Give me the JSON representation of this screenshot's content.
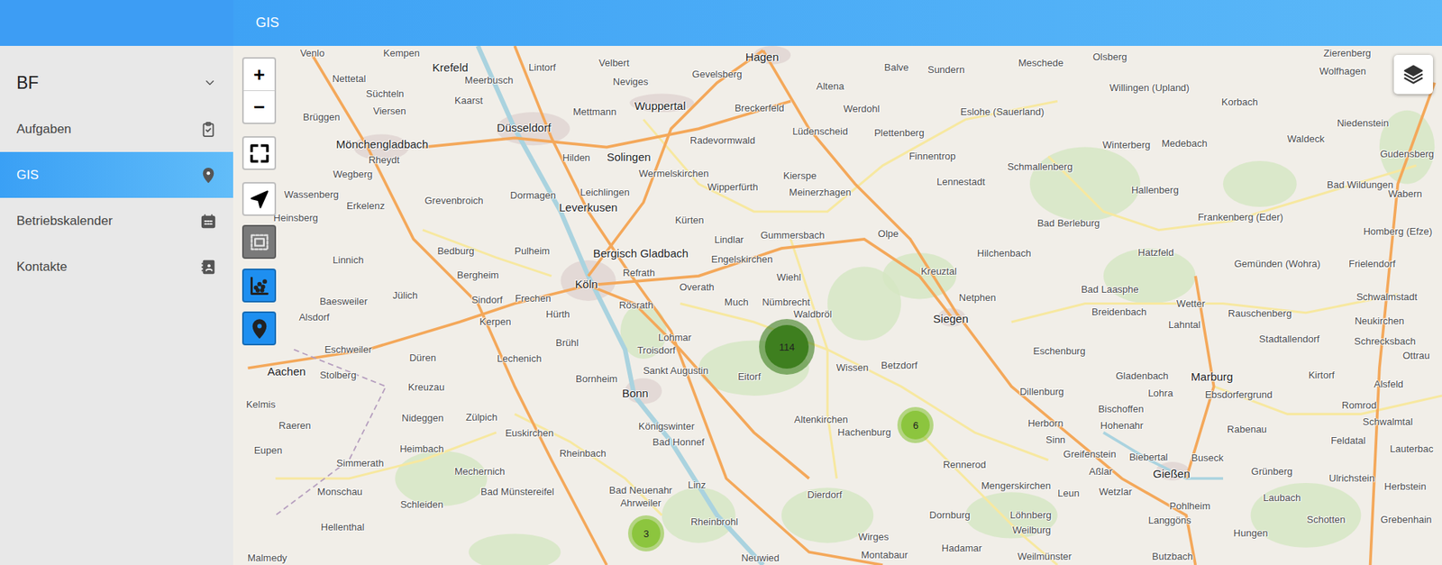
{
  "header": {
    "title": "GIS"
  },
  "sidebar": {
    "group": {
      "label": "BF",
      "expanded": true
    },
    "items": [
      {
        "label": "Aufgaben",
        "selected": false
      },
      {
        "label": "GIS",
        "selected": true
      },
      {
        "label": "Betriebskalender",
        "selected": false
      },
      {
        "label": "Kontakte",
        "selected": false
      }
    ]
  },
  "map": {
    "zoom": {
      "in": "+",
      "out": "−"
    },
    "tools": [
      {
        "active": false
      },
      {
        "active": true
      },
      {
        "active": true
      }
    ],
    "clusters": [
      {
        "count": "114",
        "color": "#3e7f1f"
      },
      {
        "count": "6",
        "color": "#8cc53e"
      },
      {
        "count": "3",
        "color": "#8cc53e"
      }
    ],
    "labels": [
      {
        "text": "Venlo",
        "kind": "town"
      },
      {
        "text": "Kempen",
        "kind": "town"
      },
      {
        "text": "Krefeld",
        "kind": "city"
      },
      {
        "text": "Lintorf",
        "kind": "town"
      },
      {
        "text": "Velbert",
        "kind": "town"
      },
      {
        "text": "Hagen",
        "kind": "city"
      },
      {
        "text": "Gevelsberg",
        "kind": "town"
      },
      {
        "text": "Balve",
        "kind": "town"
      },
      {
        "text": "Sundern",
        "kind": "town"
      },
      {
        "text": "Meschede",
        "kind": "town"
      },
      {
        "text": "Olsberg",
        "kind": "town"
      },
      {
        "text": "Zierenberg",
        "kind": "town"
      },
      {
        "text": "Nettetal",
        "kind": "town"
      },
      {
        "text": "Meerbusch",
        "kind": "town"
      },
      {
        "text": "Neviges",
        "kind": "town"
      },
      {
        "text": "Altena",
        "kind": "town"
      },
      {
        "text": "Willingen (Upland)",
        "kind": "town"
      },
      {
        "text": "Wolfhagen",
        "kind": "town"
      },
      {
        "text": "Süchteln",
        "kind": "town"
      },
      {
        "text": "Kaarst",
        "kind": "town"
      },
      {
        "text": "Wuppertal",
        "kind": "city"
      },
      {
        "text": "Mettmann",
        "kind": "town"
      },
      {
        "text": "Breckerfeld",
        "kind": "town"
      },
      {
        "text": "Werdohl",
        "kind": "town"
      },
      {
        "text": "Eslohe (Sauerland)",
        "kind": "town"
      },
      {
        "text": "Korbach",
        "kind": "town"
      },
      {
        "text": "Viersen",
        "kind": "town"
      },
      {
        "text": "Brüggen",
        "kind": "town"
      },
      {
        "text": "Düsseldorf",
        "kind": "city"
      },
      {
        "text": "Niedenstein",
        "kind": "town"
      },
      {
        "text": "Mönchengladbach",
        "kind": "city"
      },
      {
        "text": "Lüdenscheid",
        "kind": "town"
      },
      {
        "text": "Plettenberg",
        "kind": "town"
      },
      {
        "text": "Radevormwald",
        "kind": "town"
      },
      {
        "text": "Waldeck",
        "kind": "town"
      },
      {
        "text": "Winterberg",
        "kind": "town"
      },
      {
        "text": "Medebach",
        "kind": "town"
      },
      {
        "text": "Hilden",
        "kind": "town"
      },
      {
        "text": "Solingen",
        "kind": "city"
      },
      {
        "text": "Finnentrop",
        "kind": "town"
      },
      {
        "text": "Rheydt",
        "kind": "town"
      },
      {
        "text": "Gudensberg",
        "kind": "town"
      },
      {
        "text": "Schmallenberg",
        "kind": "town"
      },
      {
        "text": "Wegberg",
        "kind": "town"
      },
      {
        "text": "Wermelskirchen",
        "kind": "town"
      },
      {
        "text": "Kierspe",
        "kind": "town"
      },
      {
        "text": "Lennestadt",
        "kind": "town"
      },
      {
        "text": "Bad Wildungen",
        "kind": "town"
      },
      {
        "text": "Wipperfürth",
        "kind": "town"
      },
      {
        "text": "Leichlingen",
        "kind": "town"
      },
      {
        "text": "Meinerzhagen",
        "kind": "town"
      },
      {
        "text": "Hallenberg",
        "kind": "town"
      },
      {
        "text": "Wassenberg",
        "kind": "town"
      },
      {
        "text": "Wabern",
        "kind": "town"
      },
      {
        "text": "Dormagen",
        "kind": "town"
      },
      {
        "text": "Grevenbroich",
        "kind": "town"
      },
      {
        "text": "Erkelenz",
        "kind": "town"
      },
      {
        "text": "Leverkusen",
        "kind": "city"
      },
      {
        "text": "Heinsberg",
        "kind": "town"
      },
      {
        "text": "Frankenberg (Eder)",
        "kind": "town"
      },
      {
        "text": "Kürten",
        "kind": "town"
      },
      {
        "text": "Bad Berleburg",
        "kind": "town"
      },
      {
        "text": "Homberg (Efze)",
        "kind": "town"
      },
      {
        "text": "Gummersbach",
        "kind": "town"
      },
      {
        "text": "Olpe",
        "kind": "town"
      },
      {
        "text": "Lindlar",
        "kind": "town"
      },
      {
        "text": "Bedburg",
        "kind": "town"
      },
      {
        "text": "Pulheim",
        "kind": "town"
      },
      {
        "text": "Bergisch Gladbach",
        "kind": "city"
      },
      {
        "text": "Hilchenbach",
        "kind": "town"
      },
      {
        "text": "Hatzfeld",
        "kind": "town"
      },
      {
        "text": "Engelskirchen",
        "kind": "town"
      },
      {
        "text": "Linnich",
        "kind": "town"
      },
      {
        "text": "Gemünden (Wohra)",
        "kind": "town"
      },
      {
        "text": "Frielendorf",
        "kind": "town"
      },
      {
        "text": "Kreuztal",
        "kind": "town"
      },
      {
        "text": "Refrath",
        "kind": "town"
      },
      {
        "text": "Bergheim",
        "kind": "town"
      },
      {
        "text": "Wiehl",
        "kind": "town"
      },
      {
        "text": "Köln",
        "kind": "city"
      },
      {
        "text": "Overath",
        "kind": "town"
      },
      {
        "text": "Bad Laasphe",
        "kind": "town"
      },
      {
        "text": "Jülich",
        "kind": "town"
      },
      {
        "text": "Schwalmstadt",
        "kind": "town"
      },
      {
        "text": "Netphen",
        "kind": "town"
      },
      {
        "text": "Frechen",
        "kind": "town"
      },
      {
        "text": "Sindorf",
        "kind": "town"
      },
      {
        "text": "Baesweiler",
        "kind": "town"
      },
      {
        "text": "Much",
        "kind": "town"
      },
      {
        "text": "Nümbrecht",
        "kind": "town"
      },
      {
        "text": "Wetter",
        "kind": "town"
      },
      {
        "text": "Rösrath",
        "kind": "town"
      },
      {
        "text": "Breidenbach",
        "kind": "town"
      },
      {
        "text": "Rauschenberg",
        "kind": "town"
      },
      {
        "text": "Hürth",
        "kind": "town"
      },
      {
        "text": "Alsdorf",
        "kind": "town"
      },
      {
        "text": "Waldbröl",
        "kind": "town"
      },
      {
        "text": "Siegen",
        "kind": "city"
      },
      {
        "text": "Kerpen",
        "kind": "town"
      },
      {
        "text": "Neukirchen",
        "kind": "town"
      },
      {
        "text": "Lahntal",
        "kind": "town"
      },
      {
        "text": "Lohmar",
        "kind": "town"
      },
      {
        "text": "Stadtallendorf",
        "kind": "town"
      },
      {
        "text": "Schrecksbach",
        "kind": "town"
      },
      {
        "text": "Brühl",
        "kind": "town"
      },
      {
        "text": "Eschweiler",
        "kind": "town"
      },
      {
        "text": "Troisdorf",
        "kind": "town"
      },
      {
        "text": "Eschenburg",
        "kind": "town"
      },
      {
        "text": "Ottrau",
        "kind": "town"
      },
      {
        "text": "Düren",
        "kind": "town"
      },
      {
        "text": "Lechenich",
        "kind": "town"
      },
      {
        "text": "Betzdorf",
        "kind": "town"
      },
      {
        "text": "Wissen",
        "kind": "town"
      },
      {
        "text": "Sankt Augustin",
        "kind": "town"
      },
      {
        "text": "Aachen",
        "kind": "city"
      },
      {
        "text": "Stolberg",
        "kind": "town"
      },
      {
        "text": "Eitorf",
        "kind": "town"
      },
      {
        "text": "Marburg",
        "kind": "city"
      },
      {
        "text": "Gladenbach",
        "kind": "town"
      },
      {
        "text": "Kirtorf",
        "kind": "town"
      },
      {
        "text": "Bornheim",
        "kind": "town"
      },
      {
        "text": "Alsfeld",
        "kind": "town"
      },
      {
        "text": "Kreuzau",
        "kind": "town"
      },
      {
        "text": "Dillenburg",
        "kind": "town"
      },
      {
        "text": "Lohra",
        "kind": "town"
      },
      {
        "text": "Bonn",
        "kind": "city"
      },
      {
        "text": "Ebsdorfergrund",
        "kind": "town"
      },
      {
        "text": "Kelmis",
        "kind": "town"
      },
      {
        "text": "Romrod",
        "kind": "town"
      },
      {
        "text": "Bischoffen",
        "kind": "town"
      },
      {
        "text": "Zülpich",
        "kind": "town"
      },
      {
        "text": "Nideggen",
        "kind": "town"
      },
      {
        "text": "Altenkirchen",
        "kind": "town"
      },
      {
        "text": "Schwalmtal",
        "kind": "town"
      },
      {
        "text": "Herborn",
        "kind": "town"
      },
      {
        "text": "Raeren",
        "kind": "town"
      },
      {
        "text": "Hohenahr",
        "kind": "town"
      },
      {
        "text": "Königswinter",
        "kind": "town"
      },
      {
        "text": "Rabenau",
        "kind": "town"
      },
      {
        "text": "Hachenburg",
        "kind": "town"
      },
      {
        "text": "Euskirchen",
        "kind": "town"
      },
      {
        "text": "Sinn",
        "kind": "town"
      },
      {
        "text": "Feldatal",
        "kind": "town"
      },
      {
        "text": "Bad Honnef",
        "kind": "town"
      },
      {
        "text": "Heimbach",
        "kind": "town"
      },
      {
        "text": "Lauterbac",
        "kind": "town"
      },
      {
        "text": "Eupen",
        "kind": "town"
      },
      {
        "text": "Rheinbach",
        "kind": "town"
      },
      {
        "text": "Greifenstein",
        "kind": "town"
      },
      {
        "text": "Biebertal",
        "kind": "town"
      },
      {
        "text": "Buseck",
        "kind": "town"
      },
      {
        "text": "Simmerath",
        "kind": "town"
      },
      {
        "text": "Rennerod",
        "kind": "town"
      },
      {
        "text": "Aßlar",
        "kind": "town"
      },
      {
        "text": "Mechernich",
        "kind": "town"
      },
      {
        "text": "Gießen",
        "kind": "city"
      },
      {
        "text": "Grünberg",
        "kind": "town"
      },
      {
        "text": "Ulrichstein",
        "kind": "town"
      },
      {
        "text": "Linz",
        "kind": "town"
      },
      {
        "text": "Mengerskirchen",
        "kind": "town"
      },
      {
        "text": "Herbstein",
        "kind": "town"
      },
      {
        "text": "Bad Neuenahr",
        "kind": "town"
      },
      {
        "text": "Bad Münstereifel",
        "kind": "town"
      },
      {
        "text": "Monschau",
        "kind": "town"
      },
      {
        "text": "Wetzlar",
        "kind": "town"
      },
      {
        "text": "Leun",
        "kind": "town"
      },
      {
        "text": "Dierdorf",
        "kind": "town"
      },
      {
        "text": "Laubach",
        "kind": "town"
      },
      {
        "text": "Ahrweiler",
        "kind": "town"
      },
      {
        "text": "Schleiden",
        "kind": "town"
      },
      {
        "text": "Pohlheim",
        "kind": "town"
      },
      {
        "text": "Dornburg",
        "kind": "town"
      },
      {
        "text": "Löhnberg",
        "kind": "town"
      },
      {
        "text": "Schotten",
        "kind": "town"
      },
      {
        "text": "Grebenhain",
        "kind": "town"
      },
      {
        "text": "Langgöns",
        "kind": "town"
      },
      {
        "text": "Rheinbrohl",
        "kind": "town"
      },
      {
        "text": "Hellenthal",
        "kind": "town"
      },
      {
        "text": "Weilburg",
        "kind": "town"
      },
      {
        "text": "Hungen",
        "kind": "town"
      },
      {
        "text": "Wirges",
        "kind": "town"
      },
      {
        "text": "Hadamar",
        "kind": "town"
      },
      {
        "text": "Montabaur",
        "kind": "town"
      },
      {
        "text": "Weilmünster",
        "kind": "town"
      },
      {
        "text": "Butzbach",
        "kind": "town"
      },
      {
        "text": "Neuwied",
        "kind": "town"
      },
      {
        "text": "Malmedy",
        "kind": "town"
      }
    ]
  }
}
